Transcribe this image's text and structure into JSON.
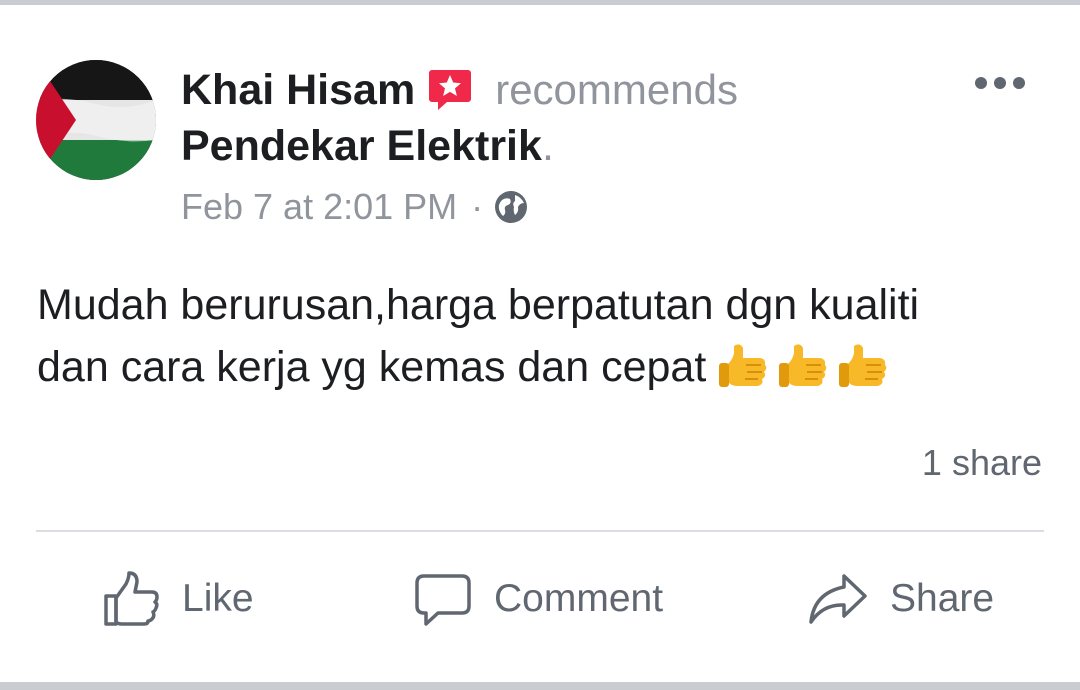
{
  "post": {
    "author": "Khai Hisam",
    "verb": "recommends",
    "page_name": "Pendekar Elektrik",
    "page_name_suffix": ".",
    "timestamp": "Feb 7 at 2:01 PM",
    "meta_separator": "·",
    "privacy_icon": "globe-icon",
    "recommend_badge_icon": "star-speech-bubble-icon",
    "body_line1": "Mudah berurusan,harga berpatutan dgn kualiti",
    "body_line2": "dan cara kerja yg kemas dan cepat",
    "emoji": [
      "thumbs-up",
      "thumbs-up",
      "thumbs-up"
    ]
  },
  "stats": {
    "shares": "1 share"
  },
  "actions": {
    "like": "Like",
    "comment": "Comment",
    "share": "Share"
  },
  "colors": {
    "primary_text": "#1c1e21",
    "secondary_text": "#90949c",
    "action_text": "#606770",
    "badge": "#f0284a",
    "emoji": "#f7b928",
    "divider": "#dadde1"
  }
}
